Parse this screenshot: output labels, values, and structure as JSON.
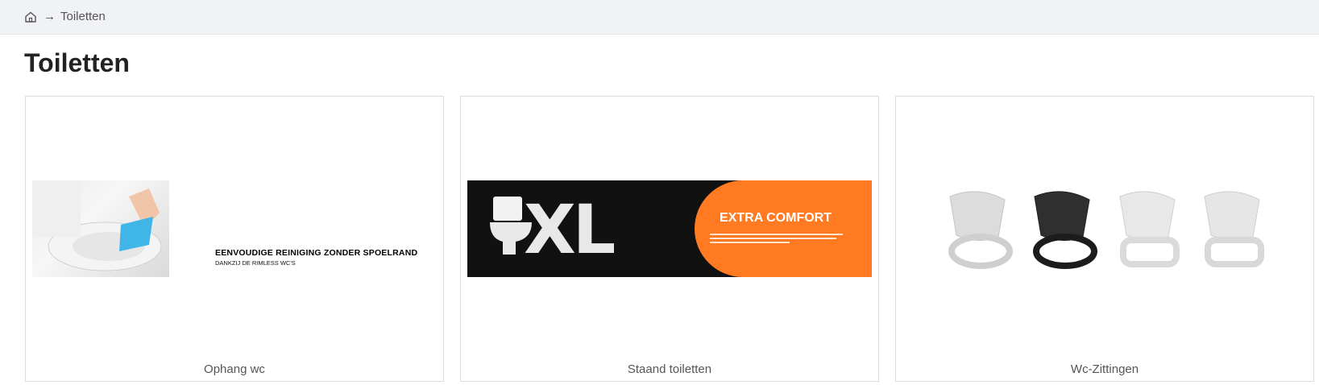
{
  "breadcrumb": {
    "arrow": "→",
    "current": "Toiletten"
  },
  "page": {
    "title": "Toiletten"
  },
  "cards": [
    {
      "caption": "Ophang wc",
      "banner": {
        "heading": "EENVOUDIGE REINIGING ZONDER SPOELRAND",
        "subheading": "DANKZIJ DE RIMLESS WC'S"
      }
    },
    {
      "caption": "Staand toiletten",
      "banner": {
        "logo_text": "XL",
        "heading": "EXTRA COMFORT",
        "colors": {
          "accent": "#ff7a21",
          "background": "#111111"
        }
      }
    },
    {
      "caption": "Wc-Zittingen",
      "banner": {
        "seat_colors": [
          "#d9d9d9",
          "#2a2a2a",
          "#e2e2e2",
          "#e0e0e0"
        ]
      }
    }
  ],
  "icons": {
    "home": "home-icon"
  }
}
